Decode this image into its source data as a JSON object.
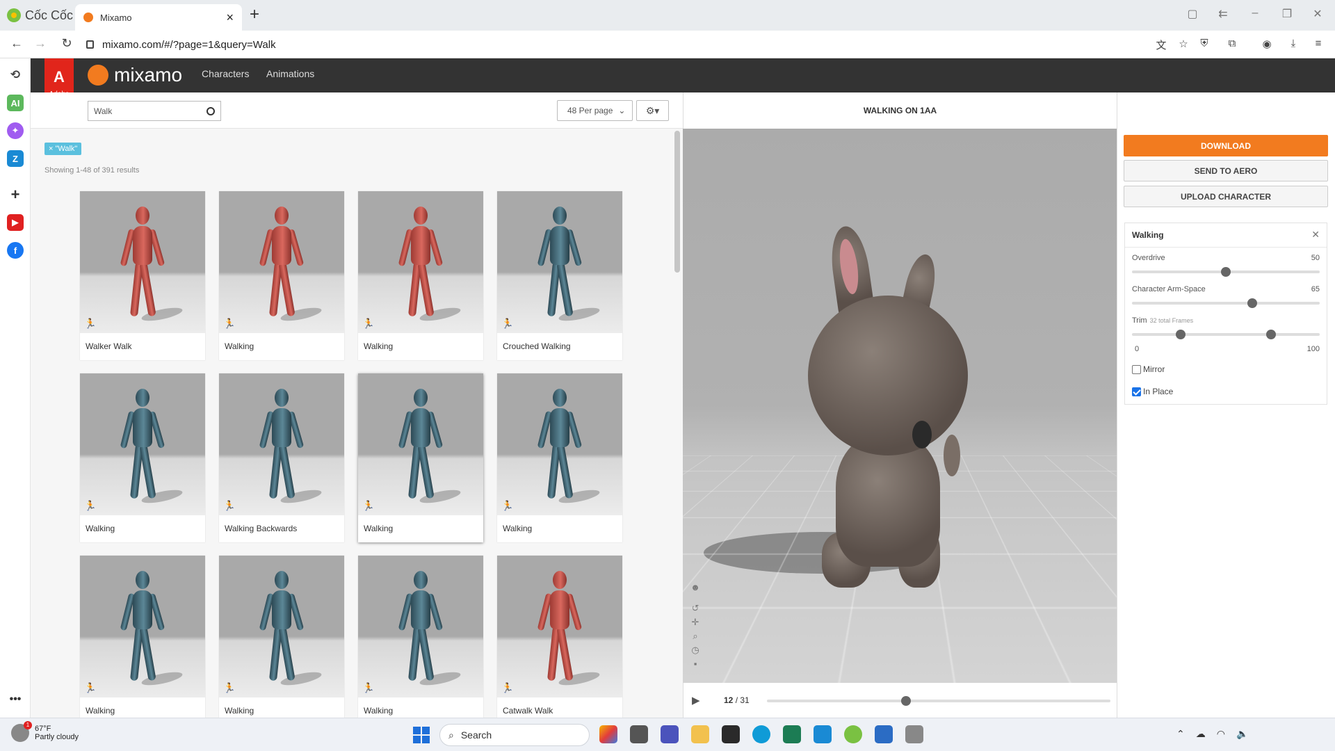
{
  "browser": {
    "brand": "Cốc Cốc",
    "tab_title": "Mixamo",
    "url": "mixamo.com/#/?page=1&query=Walk"
  },
  "mixamo": {
    "logo_text": "mixamo",
    "adobe_label": "Adobe",
    "nav": [
      "Characters",
      "Animations"
    ]
  },
  "search": {
    "value": "Walk",
    "per_page": "48 Per page",
    "filter_chip": "× \"Walk\"",
    "results_count": "Showing 1-48 of 391 results"
  },
  "results": [
    {
      "label": "Walker Walk",
      "color": "red"
    },
    {
      "label": "Walking",
      "color": "red"
    },
    {
      "label": "Walking",
      "color": "red"
    },
    {
      "label": "Crouched Walking",
      "color": "blue"
    },
    {
      "label": "Walking",
      "color": "blue"
    },
    {
      "label": "Walking Backwards",
      "color": "blue"
    },
    {
      "label": "Walking",
      "color": "blue",
      "selected": true
    },
    {
      "label": "Walking",
      "color": "blue"
    },
    {
      "label": "Walking",
      "color": "blue"
    },
    {
      "label": "Walking",
      "color": "blue"
    },
    {
      "label": "Walking",
      "color": "blue"
    },
    {
      "label": "Catwalk Walk",
      "color": "red"
    }
  ],
  "viewer": {
    "title": "WALKING ON 1AA",
    "frame_current": "12",
    "frame_total": "/ 31",
    "progress": 0.39
  },
  "actions": {
    "download": "DOWNLOAD",
    "send_aero": "SEND TO AERO",
    "upload": "UPLOAD CHARACTER"
  },
  "settings": {
    "title": "Walking",
    "overdrive_label": "Overdrive",
    "overdrive_value": "50",
    "overdrive_fraction": 0.5,
    "armspace_label": "Character Arm-Space",
    "armspace_value": "65",
    "armspace_fraction": 0.64,
    "trim_label": "Trim",
    "trim_note": "32 total Frames",
    "trim_start_fraction": 0.26,
    "trim_end_fraction": 0.74,
    "trim_min": "0",
    "trim_max": "100",
    "mirror_label": "Mirror",
    "mirror_checked": false,
    "inplace_label": "In Place",
    "inplace_checked": true
  },
  "taskbar": {
    "weather_temp": "67°F",
    "weather_desc": "Partly cloudy",
    "weather_badge": "1",
    "search_placeholder": "Search"
  },
  "colors": {
    "accent": "#f27b1f",
    "adobe_red": "#e1251b",
    "header": "#333333",
    "chip": "#5bc0de"
  }
}
